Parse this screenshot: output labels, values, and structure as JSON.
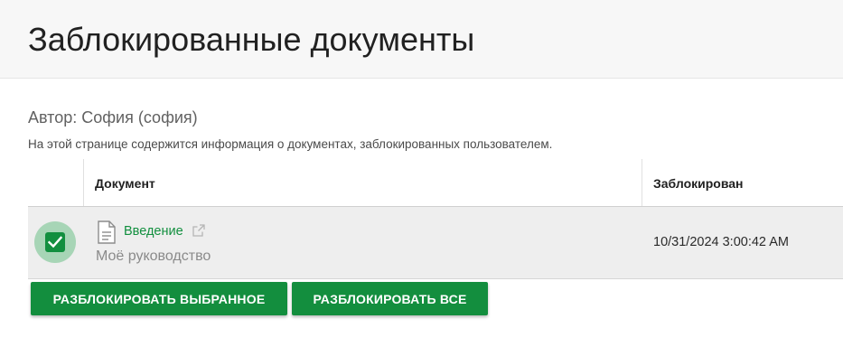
{
  "page": {
    "title": "Заблокированные документы",
    "author": "Автор: София (софия)",
    "description": "На этой странице содержится информация о документах, заблокированных пользователем."
  },
  "table": {
    "columns": [
      "",
      "Документ",
      "Заблокирован"
    ],
    "rows": [
      {
        "selected": true,
        "document_title": "Введение",
        "document_subtitle": "Моё руководство",
        "locked_at": "10/31/2024 3:00:42 AM"
      }
    ]
  },
  "actions": {
    "unlock_selected": "РАЗБЛОКИРОВАТЬ ВЫБРАННОЕ",
    "unlock_all": "РАЗБЛОКИРОВАТЬ ВСЕ"
  },
  "icons": {
    "row_icon": "document-icon",
    "link_icon": "external-link-icon",
    "checkbox_icon": "checkmark-icon"
  },
  "colors": {
    "accent": "#138e3e",
    "link": "#128f3f",
    "checkbox_halo": "#a7d5b6",
    "row_background": "#eeeeee",
    "header_background": "#f7f7f7"
  }
}
